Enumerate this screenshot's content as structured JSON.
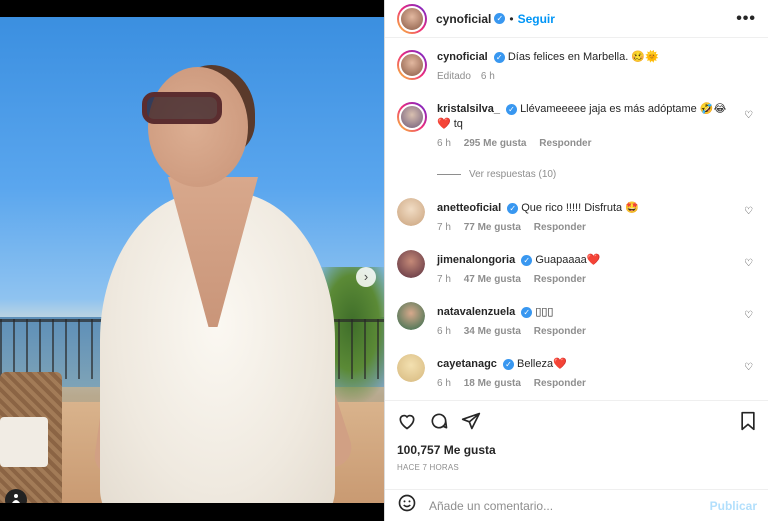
{
  "header": {
    "username": "cynoficial",
    "separator": "•",
    "follow_label": "Seguir",
    "more_label": "•••"
  },
  "caption": {
    "username": "cynoficial",
    "text": "Días felices en Marbella. 🥴🌞",
    "edited": "Editado",
    "time": "6 h"
  },
  "comments": [
    {
      "username": "kristalsilva_",
      "text": "Llévameeeee jaja es más adóptame 🤣😂❤️ tq",
      "time": "6 h",
      "likes": "295 Me gusta",
      "reply": "Responder",
      "view_replies": "Ver respuestas (10)"
    },
    {
      "username": "anetteoficial",
      "text": "Que rico !!!!! Disfruta 🤩",
      "time": "7 h",
      "likes": "77 Me gusta",
      "reply": "Responder"
    },
    {
      "username": "jimenalongoria",
      "text": "Guapaaaa❤️",
      "time": "7 h",
      "likes": "47 Me gusta",
      "reply": "Responder"
    },
    {
      "username": "natavalenzuela",
      "text": "▯▯▯",
      "time": "6 h",
      "likes": "34 Me gusta",
      "reply": "Responder"
    },
    {
      "username": "cayetanagc",
      "text": "Belleza❤️",
      "time": "6 h",
      "likes": "18 Me gusta",
      "reply": "Responder"
    }
  ],
  "post": {
    "likes": "100,757 Me gusta",
    "ago": "HACE 7 HORAS"
  },
  "add_comment": {
    "placeholder": "Añade un comentario...",
    "publish": "Publicar"
  },
  "photo": {
    "next_icon": "chevron-right-icon",
    "user_tag_icon": "user-tag-icon",
    "carousel_count": 5,
    "carousel_active": 1
  },
  "colors": {
    "link_blue": "#0095f6",
    "verified_blue": "#3897f0",
    "publish_disabled": "#b2dffc",
    "muted": "#8e8e8e"
  }
}
